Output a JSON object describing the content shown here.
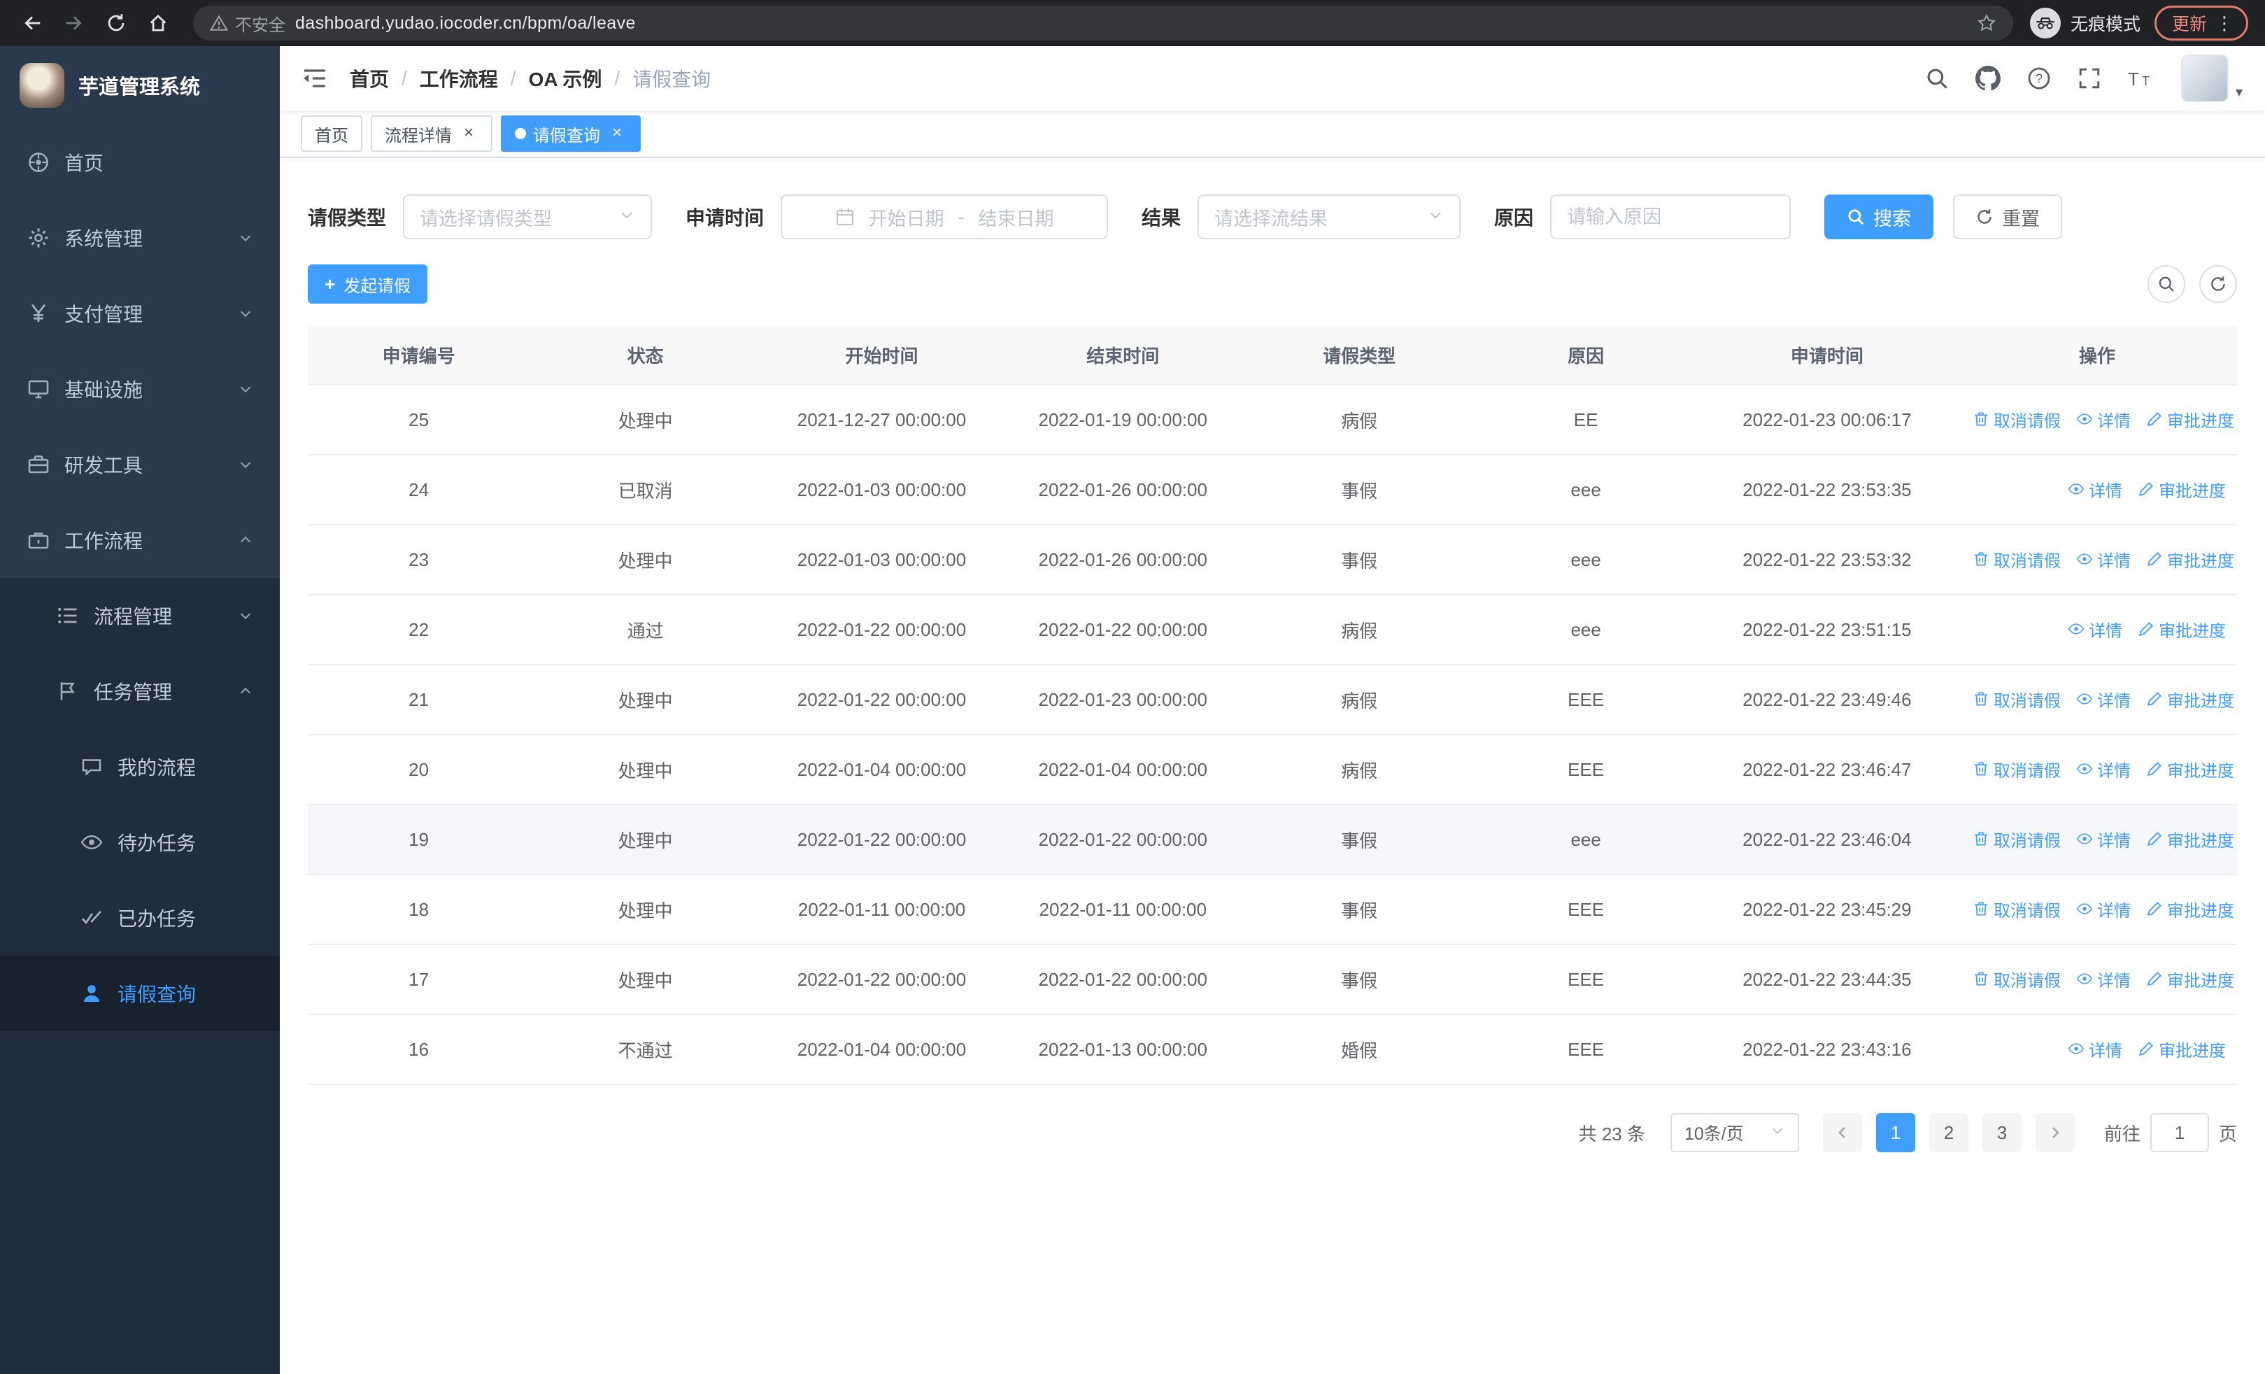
{
  "browser": {
    "security_label": "不安全",
    "url": "dashboard.yudao.iocoder.cn/bpm/oa/leave",
    "incognito_label": "无痕模式",
    "update_label": "更新"
  },
  "sidebar": {
    "app_title": "芋道管理系统",
    "items": [
      {
        "label": "首页"
      },
      {
        "label": "系统管理"
      },
      {
        "label": "支付管理"
      },
      {
        "label": "基础设施"
      },
      {
        "label": "研发工具"
      },
      {
        "label": "工作流程",
        "expanded": true
      }
    ],
    "workflow_children": [
      {
        "label": "流程管理"
      },
      {
        "label": "任务管理",
        "expanded": true
      }
    ],
    "task_children": [
      {
        "label": "我的流程"
      },
      {
        "label": "待办任务"
      },
      {
        "label": "已办任务"
      },
      {
        "label": "请假查询",
        "active": true
      }
    ]
  },
  "header": {
    "breadcrumb": [
      "首页",
      "工作流程",
      "OA 示例",
      "请假查询"
    ]
  },
  "tabs": [
    {
      "label": "首页",
      "closable": false,
      "active": false
    },
    {
      "label": "流程详情",
      "closable": true,
      "active": false
    },
    {
      "label": "请假查询",
      "closable": true,
      "active": true
    }
  ],
  "filters": {
    "leave_type_label": "请假类型",
    "leave_type_placeholder": "请选择请假类型",
    "apply_time_label": "申请时间",
    "start_date_placeholder": "开始日期",
    "range_separator": "-",
    "end_date_placeholder": "结束日期",
    "result_label": "结果",
    "result_placeholder": "请选择流结果",
    "reason_label": "原因",
    "reason_placeholder": "请输入原因",
    "search_button": "搜索",
    "reset_button": "重置"
  },
  "toolbar": {
    "create_button": "发起请假"
  },
  "table": {
    "columns": [
      "申请编号",
      "状态",
      "开始时间",
      "结束时间",
      "请假类型",
      "原因",
      "申请时间",
      "操作"
    ],
    "action_labels": {
      "cancel": "取消请假",
      "detail": "详情",
      "progress": "审批进度"
    },
    "rows": [
      {
        "id": "25",
        "status": "处理中",
        "start": "2021-12-27 00:00:00",
        "end": "2022-01-19 00:00:00",
        "type": "病假",
        "reason": "EE",
        "applied": "2022-01-23 00:06:17",
        "actions": [
          "cancel",
          "detail",
          "progress"
        ]
      },
      {
        "id": "24",
        "status": "已取消",
        "start": "2022-01-03 00:00:00",
        "end": "2022-01-26 00:00:00",
        "type": "事假",
        "reason": "eee",
        "applied": "2022-01-22 23:53:35",
        "actions": [
          "detail",
          "progress"
        ]
      },
      {
        "id": "23",
        "status": "处理中",
        "start": "2022-01-03 00:00:00",
        "end": "2022-01-26 00:00:00",
        "type": "事假",
        "reason": "eee",
        "applied": "2022-01-22 23:53:32",
        "actions": [
          "cancel",
          "detail",
          "progress"
        ]
      },
      {
        "id": "22",
        "status": "通过",
        "start": "2022-01-22 00:00:00",
        "end": "2022-01-22 00:00:00",
        "type": "病假",
        "reason": "eee",
        "applied": "2022-01-22 23:51:15",
        "actions": [
          "detail",
          "progress"
        ]
      },
      {
        "id": "21",
        "status": "处理中",
        "start": "2022-01-22 00:00:00",
        "end": "2022-01-23 00:00:00",
        "type": "病假",
        "reason": "EEE",
        "applied": "2022-01-22 23:49:46",
        "actions": [
          "cancel",
          "detail",
          "progress"
        ]
      },
      {
        "id": "20",
        "status": "处理中",
        "start": "2022-01-04 00:00:00",
        "end": "2022-01-04 00:00:00",
        "type": "病假",
        "reason": "EEE",
        "applied": "2022-01-22 23:46:47",
        "actions": [
          "cancel",
          "detail",
          "progress"
        ]
      },
      {
        "id": "19",
        "status": "处理中",
        "start": "2022-01-22 00:00:00",
        "end": "2022-01-22 00:00:00",
        "type": "事假",
        "reason": "eee",
        "applied": "2022-01-22 23:46:04",
        "actions": [
          "cancel",
          "detail",
          "progress"
        ],
        "highlight": true
      },
      {
        "id": "18",
        "status": "处理中",
        "start": "2022-01-11 00:00:00",
        "end": "2022-01-11 00:00:00",
        "type": "事假",
        "reason": "EEE",
        "applied": "2022-01-22 23:45:29",
        "actions": [
          "cancel",
          "detail",
          "progress"
        ]
      },
      {
        "id": "17",
        "status": "处理中",
        "start": "2022-01-22 00:00:00",
        "end": "2022-01-22 00:00:00",
        "type": "事假",
        "reason": "EEE",
        "applied": "2022-01-22 23:44:35",
        "actions": [
          "cancel",
          "detail",
          "progress"
        ]
      },
      {
        "id": "16",
        "status": "不通过",
        "start": "2022-01-04 00:00:00",
        "end": "2022-01-13 00:00:00",
        "type": "婚假",
        "reason": "EEE",
        "applied": "2022-01-22 23:43:16",
        "actions": [
          "detail",
          "progress"
        ]
      }
    ]
  },
  "pagination": {
    "total_text": "共 23 条",
    "page_size": "10条/页",
    "pages": [
      "1",
      "2",
      "3"
    ],
    "active_page": "1",
    "goto_label": "前往",
    "goto_value": "1",
    "goto_unit": "页"
  }
}
